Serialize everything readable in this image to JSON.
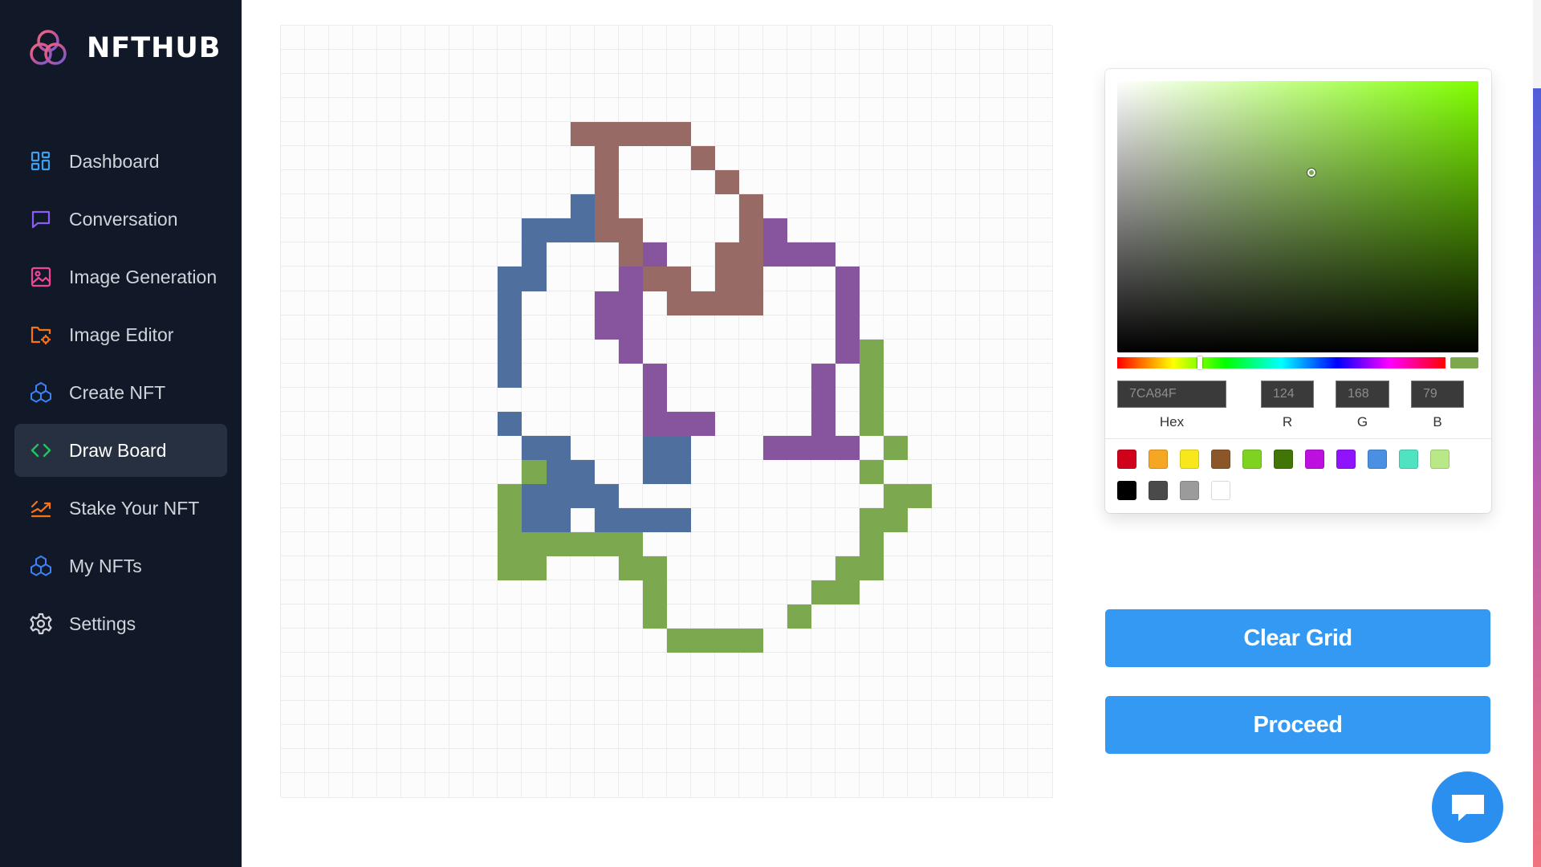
{
  "app": {
    "name": "NFTHUB"
  },
  "sidebar": {
    "items": [
      {
        "label": "Dashboard",
        "icon": "dashboard-icon",
        "color": "#3aa0f0",
        "active": false
      },
      {
        "label": "Conversation",
        "icon": "chat-bubble-icon",
        "color": "#8b5cf6",
        "active": false
      },
      {
        "label": "Image Generation",
        "icon": "image-icon",
        "color": "#ec4899",
        "active": false
      },
      {
        "label": "Image Editor",
        "icon": "folder-gear-icon",
        "color": "#f97316",
        "active": false
      },
      {
        "label": "Create NFT",
        "icon": "cubes-icon",
        "color": "#3b82f6",
        "active": false
      },
      {
        "label": "Draw Board",
        "icon": "code-brackets-icon",
        "color": "#22c55e",
        "active": true
      },
      {
        "label": "Stake Your NFT",
        "icon": "stake-icon",
        "color": "#f97316",
        "active": false
      },
      {
        "label": "My NFTs",
        "icon": "cubes-icon",
        "color": "#3b82f6",
        "active": false
      },
      {
        "label": "Settings",
        "icon": "gear-icon",
        "color": "#d1d5db",
        "active": false
      }
    ]
  },
  "draw_board": {
    "grid_size": 32,
    "palette": {
      "B": "#4f6f9e",
      "R": "#986a66",
      "P": "#87549e",
      "G": "#7ca84f"
    },
    "rows": [
      "................................",
      "................................",
      "................................",
      "................................",
      "............RRRRR...............",
      ".............R...R..............",
      ".............R....R.............",
      "............BR.....R............",
      "..........BBBRR....RP...........",
      "..........B...RP..RRPPP.........",
      ".........BB...PRR.RR...P........",
      ".........B...PP.RRRR...P........",
      ".........B...PP........P........",
      ".........B....P........PG.......",
      ".........B.....P......P.G.......",
      "...............P......P.G.......",
      ".........B.....PPP....P.G.......",
      "..........BB...BB...PPPP.G......",
      "..........GBB..BB.......G.......",
      ".........GBBBB...........GG.....",
      ".........GBB.BBBB.......GG......",
      ".........GGGGGG.........G.......",
      ".........GG...GG.......GG.......",
      "...............G......GG........",
      "...............G.....G..........",
      "................GGGG............",
      "................................",
      "................................",
      "................................",
      "................................",
      "................................",
      "................................"
    ]
  },
  "color_picker": {
    "current_color": "#7ca84f",
    "hue_color": "#7fff00",
    "hex_value": "7CA84F",
    "r_value": "124",
    "g_value": "168",
    "b_value": "79",
    "hex_label": "Hex",
    "r_label": "R",
    "g_label": "G",
    "b_label": "B",
    "presets": [
      "#d0021b",
      "#f5a623",
      "#f8e71c",
      "#8b572a",
      "#7ed321",
      "#417505",
      "#bd10e0",
      "#9013fe",
      "#4a90e2",
      "#50e3c2",
      "#b8e986",
      "#000000",
      "#4a4a4a",
      "#9b9b9b",
      "#ffffff"
    ]
  },
  "actions": {
    "clear_label": "Clear Grid",
    "proceed_label": "Proceed"
  }
}
